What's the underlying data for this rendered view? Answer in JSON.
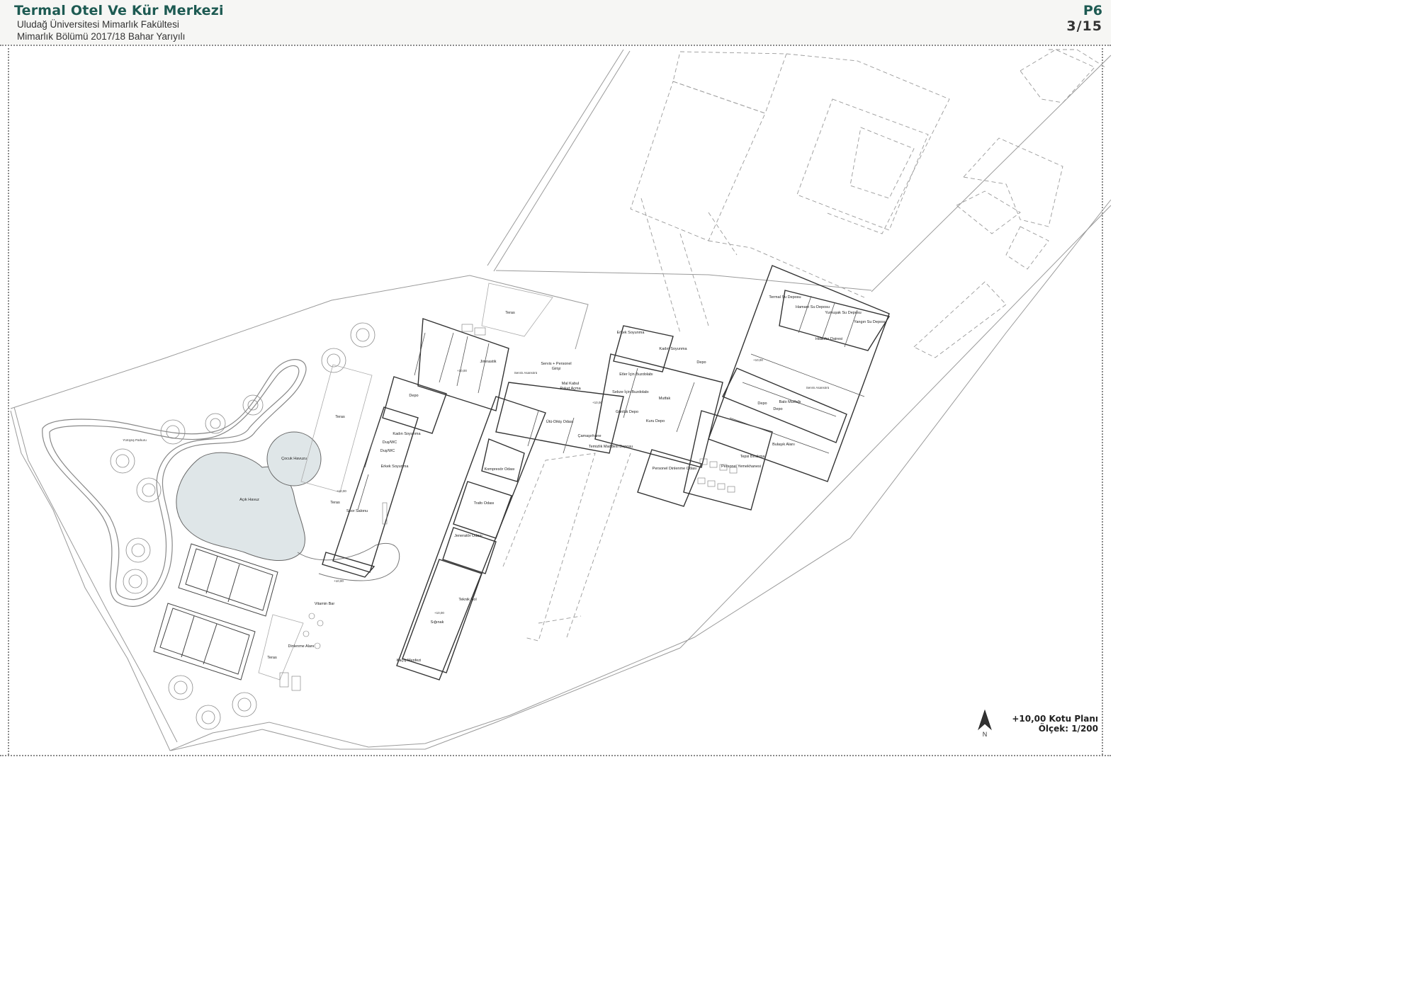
{
  "header": {
    "title": "Termal Otel Ve Kür Merkezi",
    "subtitle_line1": "Uludağ Üniversitesi Mimarlık Fakültesi",
    "subtitle_line2": "Mimarlık Bölümü 2017/18 Bahar Yarıyılı",
    "sheet_code": "P6",
    "sheet_number": "3/15"
  },
  "legend": {
    "plan_name": "+10,00 Kotu Planı",
    "scale": "Ölçek: 1/200",
    "north_label": "N"
  },
  "rooms": {
    "teras_top": "Teras",
    "jimnastik": "Jimnastik",
    "servis_personel": "Servis + Personel",
    "servis_personel_2": "Girişi",
    "servis_asansoru": "Servis Asansörü",
    "mal_kabul": "Mal Kabul",
    "paket_acma": "Paket Açma",
    "depo_left": "Depo",
    "kadin_soyunma": "Kadın Soyunma",
    "dus_wc_1": "Duş/WC",
    "dus_wc_2": "Duş/WC",
    "erkek_soyunma_left": "Erkek Soyunma",
    "spor_salonu": "Spor Salonu",
    "teras_mid": "Teras",
    "teras_low": "Teras",
    "cocuk_havuzu": "Çocuk Havuzu",
    "acik_havuz": "Açık Havuz",
    "yuruyus_parkuru": "Yürüyüş Parkuru",
    "vitamin_bar": "Vitamin Bar",
    "dinlenme_alani": "Dinlenme Alanı",
    "kompresor": "Kompresör Odası",
    "trafo": "Trafo Odası",
    "jenerator": "Jeneratör Odası",
    "siginak": "Sığınak",
    "teknik_hol": "Teknik Hol",
    "kacis_menfezi": "Kaçış Menfezi",
    "utu_dikis": "Ütü-Dikiş Odası",
    "camasirhane": "Çamaşırhane",
    "temizlik_maddesi": "Temizlik Maddesi Deposu",
    "erkek_soyunma_right": "Erkek Soyunma",
    "kadin_soyunma_right": "Kadın Soyunma",
    "depo_kitchen": "Depo",
    "et_buzdolabi": "Etler İçin Buzdolabı",
    "sebze_buzdolabi": "Sebze İçin Buzdolabı",
    "mutfak": "Mutfak",
    "gunluk_depo": "Günlük Depo",
    "kuru_depo": "Kuru Depo",
    "personel_dinlenme": "Personel Dinlenme Odası",
    "tepsi_birakma": "Tepsi Bırakma",
    "personel_yemekhanesi": "Personel Yemekhanesi",
    "termal_su": "Termal Su Deposu",
    "hamam_su": "Hamam Su Deposu",
    "yumusak_su": "Yumuşak Su Deposu",
    "yangin_su": "Yangın Su Deposu",
    "hidrofor": "Hidrofor Dairesi",
    "balo_mutfagi": "Balo Mutfağı",
    "depo_balo_1": "Depo",
    "depo_balo_2": "Depo",
    "bulasik": "Bulaşık Alanı",
    "servis_asansoru_2": "Servis Asansörü"
  },
  "levels": {
    "l1": "+10,00",
    "l2": "+10,00",
    "l3": "+10,00",
    "l4": "+10,00",
    "l5": "+10,00",
    "l6": "+10,00"
  }
}
